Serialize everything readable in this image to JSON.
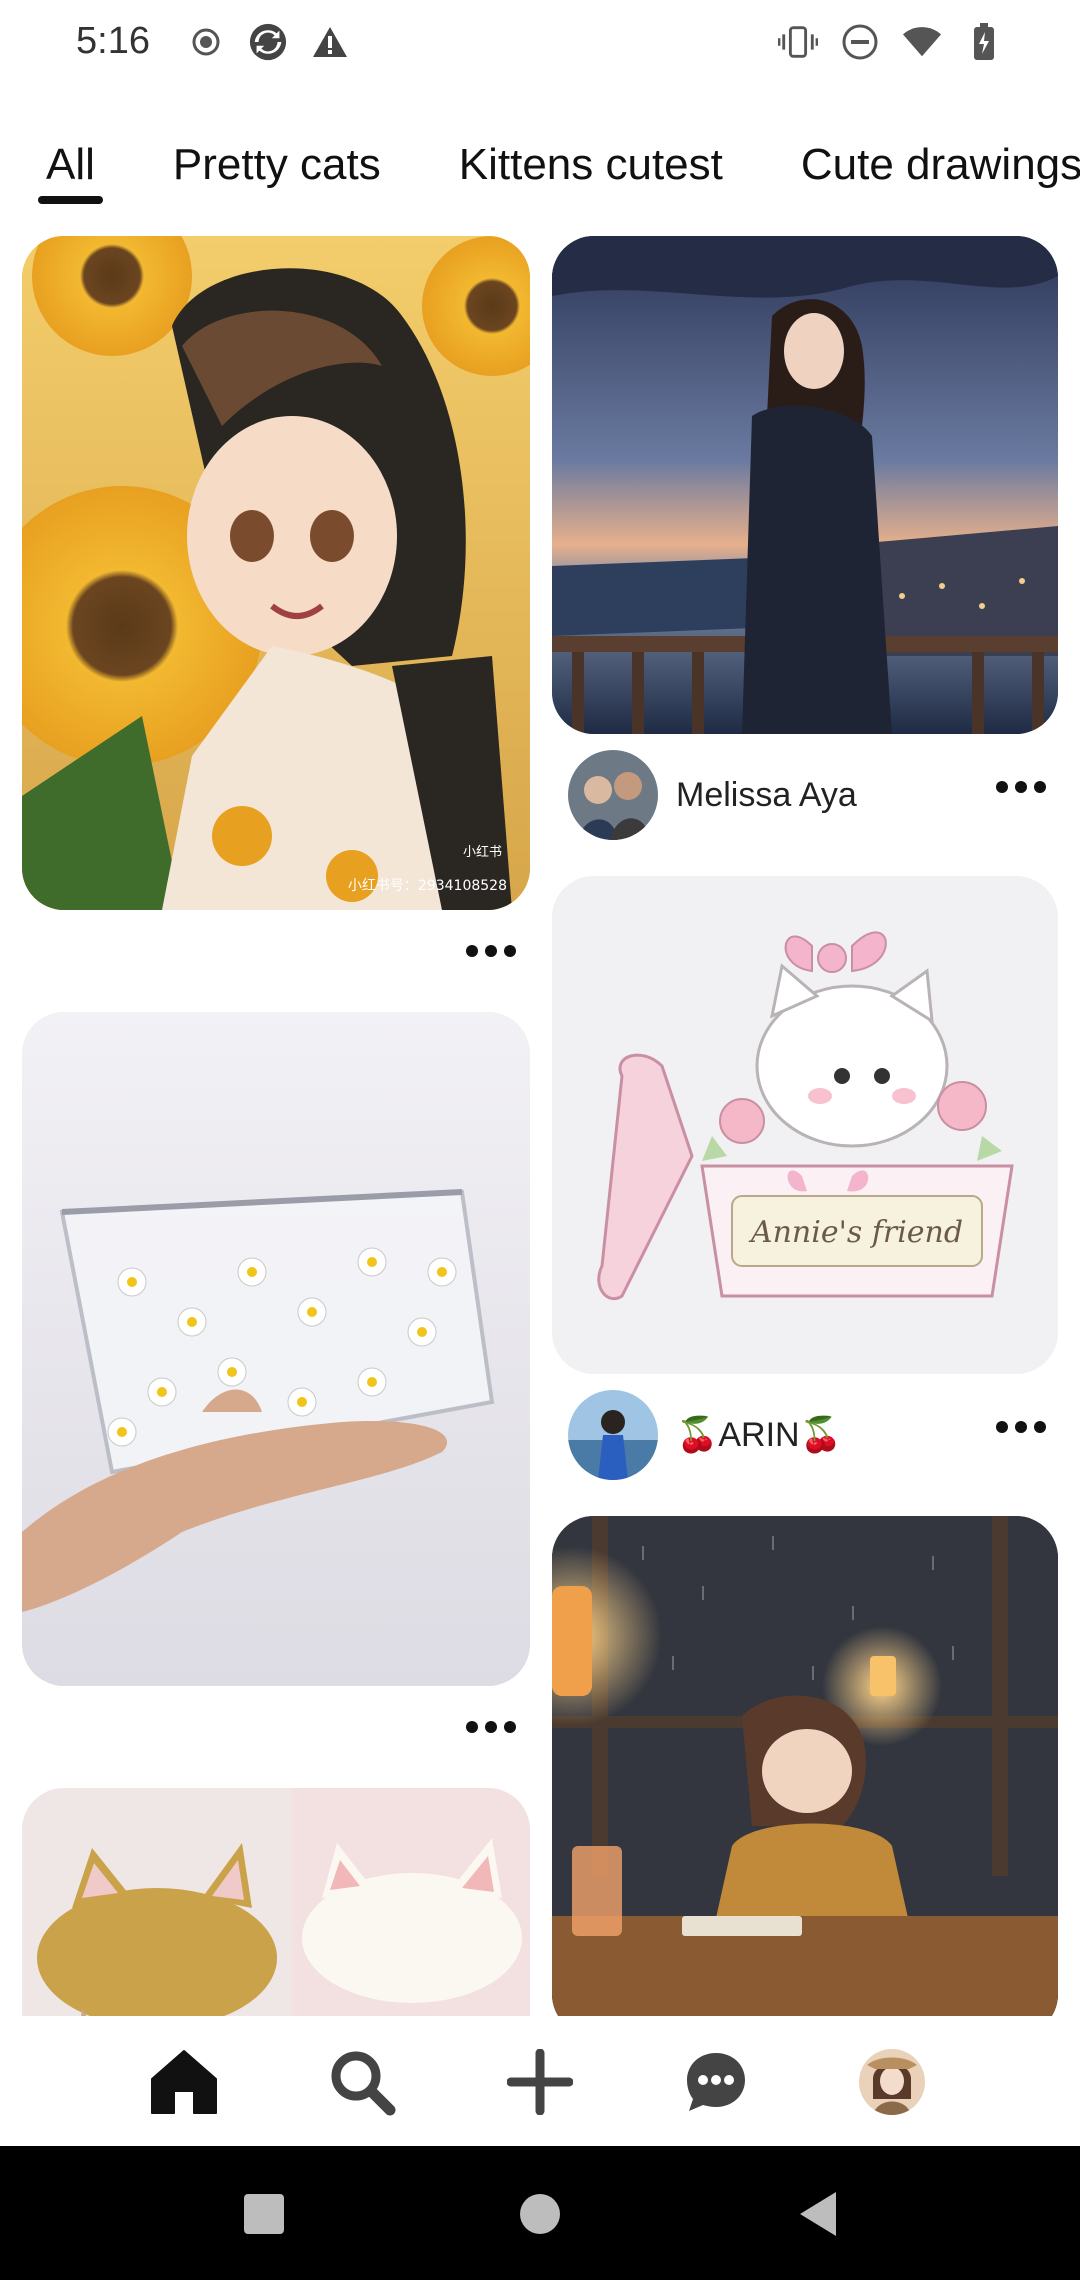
{
  "status_bar": {
    "time": "5:16",
    "left_icons": [
      "record-icon",
      "sync-icon",
      "warning-icon"
    ],
    "right_icons": [
      "vibrate-icon",
      "do-not-disturb-icon",
      "wifi-icon",
      "battery-icon"
    ]
  },
  "tabs": [
    {
      "label": "All",
      "active": true
    },
    {
      "label": "Pretty cats",
      "active": false
    },
    {
      "label": "Kittens cutest",
      "active": false
    },
    {
      "label": "Cute drawings",
      "active": false
    }
  ],
  "feed": {
    "left_column": [
      {
        "image": "sunflower-anime-girl-image",
        "watermark": "小红书号：2934108528"
      },
      {
        "image": "clear-daisy-pouch-image"
      },
      {
        "image": "cat-ear-berets-image"
      }
    ],
    "right_column": [
      {
        "image": "girl-on-balcony-sunset-image",
        "creator": "Melissa Aya"
      },
      {
        "image": "annies-friend-kitten-box-image",
        "creator": "🍒ARIN🍒",
        "caption_in_image": "Annie's friend"
      },
      {
        "image": "girl-reading-rain-window-image"
      }
    ]
  },
  "bottom_nav": {
    "items": [
      "home-icon",
      "search-icon",
      "create-icon",
      "messages-icon",
      "profile-avatar"
    ],
    "active": "home-icon"
  },
  "system_nav": [
    "recents-button",
    "home-button",
    "back-button"
  ]
}
